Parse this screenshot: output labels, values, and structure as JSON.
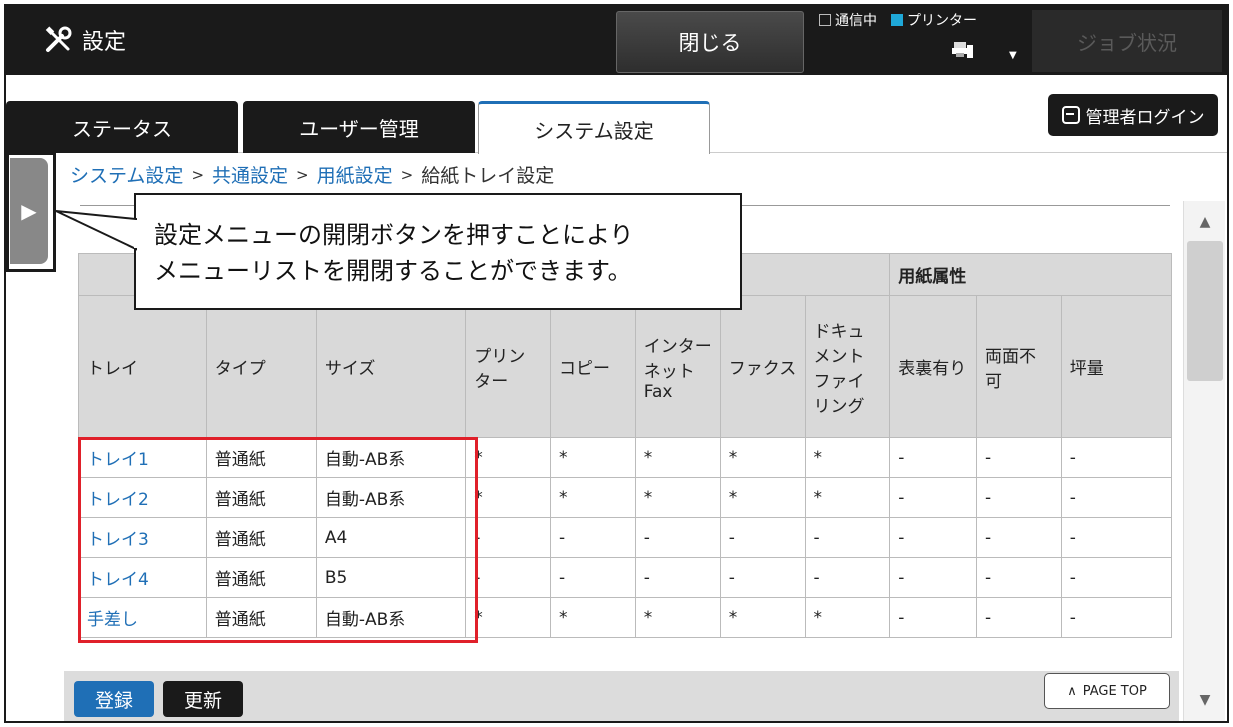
{
  "app": {
    "title": "設定"
  },
  "topbar": {
    "close_label": "閉じる",
    "comm_label": "通信中",
    "printer_label": "プリンター",
    "job_status_label": "ジョブ状況"
  },
  "tabs": [
    {
      "label": "ステータス",
      "active": false
    },
    {
      "label": "ユーザー管理",
      "active": false
    },
    {
      "label": "システム設定",
      "active": true
    }
  ],
  "admin_login_label": "管理者ログイン",
  "breadcrumb": {
    "items": [
      "システム設定",
      "共通設定",
      "用紙設定"
    ],
    "current": "給紙トレイ設定",
    "separator": ">"
  },
  "callout": {
    "line1": "設定メニューの開閉ボタンを押すことにより",
    "line2": "メニューリストを開閉することができます。"
  },
  "table": {
    "group_header": "用紙属性",
    "headers": {
      "tray": "トレイ",
      "type": "タイプ",
      "size": "サイズ",
      "printer": "プリンター",
      "copy": "コピー",
      "ifax": "インターネットFax",
      "fax": "ファクス",
      "docfiling": "ドキュメントファイリング",
      "duplex_print": "表裏有り",
      "no_duplex": "両面不可",
      "weight": "坪量"
    },
    "rows": [
      {
        "tray": "トレイ1",
        "type": "普通紙",
        "size": "自動-AB系",
        "printer": "*",
        "copy": "*",
        "ifax": "*",
        "fax": "*",
        "doc": "*",
        "a1": "-",
        "a2": "-",
        "a3": "-"
      },
      {
        "tray": "トレイ2",
        "type": "普通紙",
        "size": "自動-AB系",
        "printer": "*",
        "copy": "*",
        "ifax": "*",
        "fax": "*",
        "doc": "*",
        "a1": "-",
        "a2": "-",
        "a3": "-"
      },
      {
        "tray": "トレイ3",
        "type": "普通紙",
        "size": "A4",
        "printer": "-",
        "copy": "-",
        "ifax": "-",
        "fax": "-",
        "doc": "-",
        "a1": "-",
        "a2": "-",
        "a3": "-"
      },
      {
        "tray": "トレイ4",
        "type": "普通紙",
        "size": "B5",
        "printer": "-",
        "copy": "-",
        "ifax": "-",
        "fax": "-",
        "doc": "-",
        "a1": "-",
        "a2": "-",
        "a3": "-"
      },
      {
        "tray": "手差し",
        "type": "普通紙",
        "size": "自動-AB系",
        "printer": "*",
        "copy": "*",
        "ifax": "*",
        "fax": "*",
        "doc": "*",
        "a1": "-",
        "a2": "-",
        "a3": "-"
      }
    ]
  },
  "buttons": {
    "register": "登録",
    "update": "更新",
    "page_top": "PAGE TOP"
  },
  "colors": {
    "link": "#1f6fb6",
    "highlight_box": "#e0202a",
    "printer_indicator": "#1fa8d8"
  },
  "icons": {
    "settings": "tools-icon",
    "printer": "printer-icon",
    "login": "login-icon",
    "menu_toggle": "menu-toggle-arrow-icon"
  }
}
